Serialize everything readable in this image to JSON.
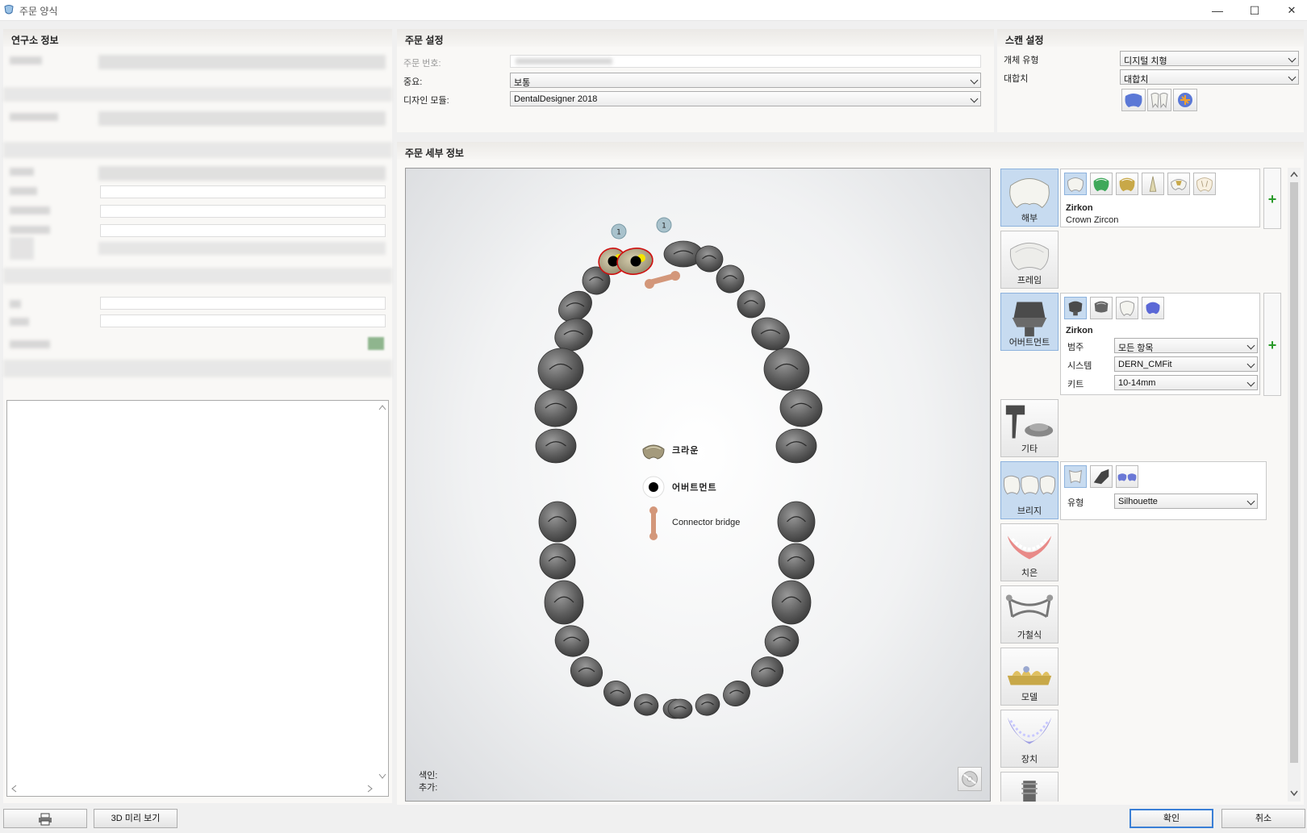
{
  "window": {
    "title": "주문 양식",
    "minimize": "—",
    "maximize": "☐",
    "close": "✕"
  },
  "lab_info": {
    "title": "연구소 정보"
  },
  "order_settings": {
    "title": "주문 설정",
    "order_no_label": "주문 번호:",
    "priority_label": "중요:",
    "priority_value": "보통",
    "module_label": "디자인 모듈:",
    "module_value": "DentalDesigner 2018"
  },
  "scan_settings": {
    "title": "스캔 설정",
    "object_type_label": "개체 유형",
    "object_type_value": "디지털 치형",
    "antagonist_label": "대합치",
    "antagonist_value": "대합치"
  },
  "order_details": {
    "title": "주문 세부 정보",
    "legend": {
      "crown": "크라운",
      "abutment": "어버트먼트",
      "connector": "Connector bridge"
    },
    "shade_label": "색인:",
    "extra_label": "추가:",
    "tooth_badges": [
      "1",
      "1"
    ]
  },
  "categories": [
    {
      "key": "anatomy",
      "label": "해부",
      "active": true
    },
    {
      "key": "frame",
      "label": "프레임",
      "active": false
    },
    {
      "key": "abutment",
      "label": "어버트먼트",
      "active": true
    },
    {
      "key": "other",
      "label": "기타",
      "active": false
    },
    {
      "key": "bridge",
      "label": "브리지",
      "active": true
    },
    {
      "key": "gingiva",
      "label": "치은",
      "active": false
    },
    {
      "key": "removable",
      "label": "가철식",
      "active": false
    },
    {
      "key": "model",
      "label": "모델",
      "active": false
    },
    {
      "key": "appliance",
      "label": "장치",
      "active": false
    }
  ],
  "anatomy_panel": {
    "material": "Zirkon",
    "description": "Crown Zircon"
  },
  "abutment_panel": {
    "material": "Zirkon",
    "category_label": "범주",
    "category_value": "모든 항목",
    "system_label": "시스템",
    "system_value": "DERN_CMFit",
    "kit_label": "키트",
    "kit_value": "10-14mm"
  },
  "bridge_panel": {
    "type_label": "유형",
    "type_value": "Silhouette"
  },
  "buttons": {
    "preview_3d": "3D 미리 보기",
    "ok": "확인",
    "cancel": "취소"
  },
  "colors": {
    "accent": "#3a7fd6",
    "active_tab": "#c7dbf0",
    "tooth_outline": "#d01010",
    "plus_green": "#2a9a2a"
  }
}
